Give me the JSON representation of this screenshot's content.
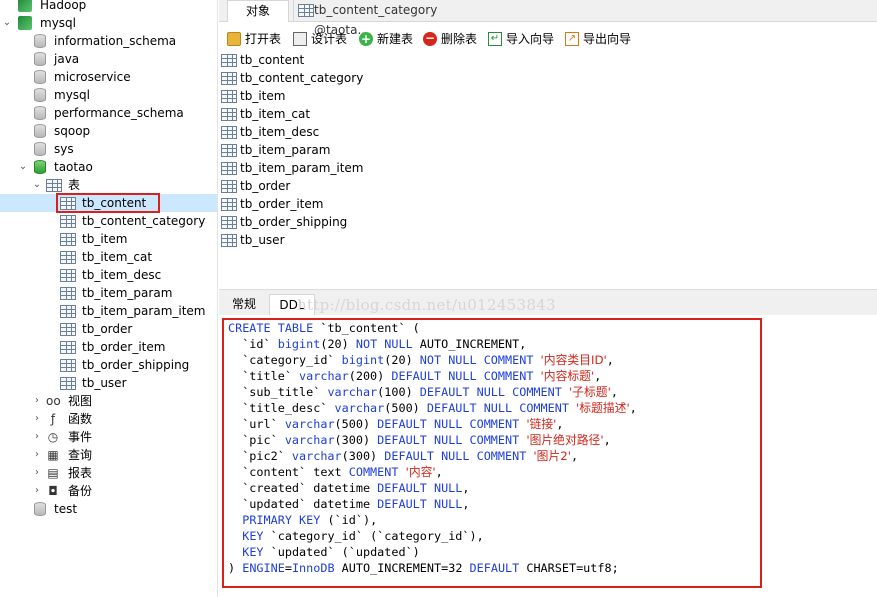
{
  "tree": {
    "rows": [
      {
        "label": "Hadoop",
        "icon": "connection-icon",
        "level": 0,
        "twisty": ""
      },
      {
        "label": "mysql",
        "icon": "connection-icon",
        "level": 0,
        "twisty": "expanded"
      },
      {
        "label": "information_schema",
        "icon": "database-icon",
        "level": 1,
        "twisty": ""
      },
      {
        "label": "java",
        "icon": "database-icon",
        "level": 1,
        "twisty": ""
      },
      {
        "label": "microservice",
        "icon": "database-icon",
        "level": 1,
        "twisty": ""
      },
      {
        "label": "mysql",
        "icon": "database-icon",
        "level": 1,
        "twisty": ""
      },
      {
        "label": "performance_schema",
        "icon": "database-icon",
        "level": 1,
        "twisty": ""
      },
      {
        "label": "sqoop",
        "icon": "database-icon",
        "level": 1,
        "twisty": ""
      },
      {
        "label": "sys",
        "icon": "database-icon",
        "level": 1,
        "twisty": ""
      },
      {
        "label": "taotao",
        "icon": "database-open-icon",
        "level": 1,
        "twisty": "expanded"
      },
      {
        "label": "表",
        "icon": "tables-folder-icon",
        "level": 2,
        "twisty": "expanded"
      },
      {
        "label": "tb_content",
        "icon": "table-icon",
        "level": 3,
        "twisty": "",
        "selected": true
      },
      {
        "label": "tb_content_category",
        "icon": "table-icon",
        "level": 3,
        "twisty": ""
      },
      {
        "label": "tb_item",
        "icon": "table-icon",
        "level": 3,
        "twisty": ""
      },
      {
        "label": "tb_item_cat",
        "icon": "table-icon",
        "level": 3,
        "twisty": ""
      },
      {
        "label": "tb_item_desc",
        "icon": "table-icon",
        "level": 3,
        "twisty": ""
      },
      {
        "label": "tb_item_param",
        "icon": "table-icon",
        "level": 3,
        "twisty": ""
      },
      {
        "label": "tb_item_param_item",
        "icon": "table-icon",
        "level": 3,
        "twisty": ""
      },
      {
        "label": "tb_order",
        "icon": "table-icon",
        "level": 3,
        "twisty": ""
      },
      {
        "label": "tb_order_item",
        "icon": "table-icon",
        "level": 3,
        "twisty": ""
      },
      {
        "label": "tb_order_shipping",
        "icon": "table-icon",
        "level": 3,
        "twisty": ""
      },
      {
        "label": "tb_user",
        "icon": "table-icon",
        "level": 3,
        "twisty": ""
      },
      {
        "label": "视图",
        "icon": "views-icon",
        "level": 2,
        "twisty": "collapsed"
      },
      {
        "label": "函数",
        "icon": "function-icon",
        "level": 2,
        "twisty": "collapsed"
      },
      {
        "label": "事件",
        "icon": "event-icon",
        "level": 2,
        "twisty": "collapsed"
      },
      {
        "label": "查询",
        "icon": "query-icon",
        "level": 2,
        "twisty": "collapsed"
      },
      {
        "label": "报表",
        "icon": "report-icon",
        "level": 2,
        "twisty": "collapsed"
      },
      {
        "label": "备份",
        "icon": "backup-icon",
        "level": 2,
        "twisty": "collapsed"
      },
      {
        "label": "test",
        "icon": "database-icon",
        "level": 1,
        "twisty": ""
      }
    ]
  },
  "tabs": {
    "objects_label": "对象",
    "query_tab_label": "tb_content_category @taota..."
  },
  "toolbar": {
    "open_table": "打开表",
    "design_table": "设计表",
    "new_table": "新建表",
    "delete_table": "删除表",
    "import_wizard": "导入向导",
    "export_wizard": "导出向导"
  },
  "object_list": [
    "tb_content",
    "tb_content_category",
    "tb_item",
    "tb_item_cat",
    "tb_item_desc",
    "tb_item_param",
    "tb_item_param_item",
    "tb_order",
    "tb_order_item",
    "tb_order_shipping",
    "tb_user"
  ],
  "info_tabs": {
    "general": "常规",
    "ddl": "DDL",
    "watermark": "http://blog.csdn.net/u012453843"
  },
  "ddl_lines": [
    [
      {
        "t": "CREATE TABLE",
        "c": "kw"
      },
      {
        "t": " `tb_content` ("
      }
    ],
    [
      {
        "t": "  `id` "
      },
      {
        "t": "bigint",
        "c": "kw"
      },
      {
        "t": "(20) "
      },
      {
        "t": "NOT NULL",
        "c": "kw"
      },
      {
        "t": " AUTO_INCREMENT,"
      }
    ],
    [
      {
        "t": "  `category_id` "
      },
      {
        "t": "bigint",
        "c": "kw"
      },
      {
        "t": "(20) "
      },
      {
        "t": "NOT NULL COMMENT",
        "c": "kw"
      },
      {
        "t": " "
      },
      {
        "t": "'内容类目ID'",
        "c": "str"
      },
      {
        "t": ","
      }
    ],
    [
      {
        "t": "  `title` "
      },
      {
        "t": "varchar",
        "c": "kw"
      },
      {
        "t": "(200) "
      },
      {
        "t": "DEFAULT NULL COMMENT",
        "c": "kw"
      },
      {
        "t": " "
      },
      {
        "t": "'内容标题'",
        "c": "str"
      },
      {
        "t": ","
      }
    ],
    [
      {
        "t": "  `sub_title` "
      },
      {
        "t": "varchar",
        "c": "kw"
      },
      {
        "t": "(100) "
      },
      {
        "t": "DEFAULT NULL COMMENT",
        "c": "kw"
      },
      {
        "t": " "
      },
      {
        "t": "'子标题'",
        "c": "str"
      },
      {
        "t": ","
      }
    ],
    [
      {
        "t": "  `title_desc` "
      },
      {
        "t": "varchar",
        "c": "kw"
      },
      {
        "t": "(500) "
      },
      {
        "t": "DEFAULT NULL COMMENT",
        "c": "kw"
      },
      {
        "t": " "
      },
      {
        "t": "'标题描述'",
        "c": "str"
      },
      {
        "t": ","
      }
    ],
    [
      {
        "t": "  `url` "
      },
      {
        "t": "varchar",
        "c": "kw"
      },
      {
        "t": "(500) "
      },
      {
        "t": "DEFAULT NULL COMMENT",
        "c": "kw"
      },
      {
        "t": " "
      },
      {
        "t": "'链接'",
        "c": "str"
      },
      {
        "t": ","
      }
    ],
    [
      {
        "t": "  `pic` "
      },
      {
        "t": "varchar",
        "c": "kw"
      },
      {
        "t": "(300) "
      },
      {
        "t": "DEFAULT NULL COMMENT",
        "c": "kw"
      },
      {
        "t": " "
      },
      {
        "t": "'图片绝对路径'",
        "c": "str"
      },
      {
        "t": ","
      }
    ],
    [
      {
        "t": "  `pic2` "
      },
      {
        "t": "varchar",
        "c": "kw"
      },
      {
        "t": "(300) "
      },
      {
        "t": "DEFAULT NULL COMMENT",
        "c": "kw"
      },
      {
        "t": " "
      },
      {
        "t": "'图片2'",
        "c": "str"
      },
      {
        "t": ","
      }
    ],
    [
      {
        "t": "  `content` text "
      },
      {
        "t": "COMMENT",
        "c": "kw"
      },
      {
        "t": " "
      },
      {
        "t": "'内容'",
        "c": "str"
      },
      {
        "t": ","
      }
    ],
    [
      {
        "t": "  `created` datetime "
      },
      {
        "t": "DEFAULT NULL",
        "c": "kw"
      },
      {
        "t": ","
      }
    ],
    [
      {
        "t": "  `updated` datetime "
      },
      {
        "t": "DEFAULT NULL",
        "c": "kw"
      },
      {
        "t": ","
      }
    ],
    [
      {
        "t": "  "
      },
      {
        "t": "PRIMARY KEY",
        "c": "kw"
      },
      {
        "t": " (`id`),"
      }
    ],
    [
      {
        "t": "  "
      },
      {
        "t": "KEY",
        "c": "kw"
      },
      {
        "t": " `category_id` (`category_id`),"
      }
    ],
    [
      {
        "t": "  "
      },
      {
        "t": "KEY",
        "c": "kw"
      },
      {
        "t": " `updated` (`updated`)"
      }
    ],
    [
      {
        "t": ") "
      },
      {
        "t": "ENGINE",
        "c": "kw"
      },
      {
        "t": "="
      },
      {
        "t": "InnoDB",
        "c": "kw"
      },
      {
        "t": " AUTO_INCREMENT=32 "
      },
      {
        "t": "DEFAULT",
        "c": "kw"
      },
      {
        "t": " CHARSET=utf8;"
      }
    ]
  ]
}
